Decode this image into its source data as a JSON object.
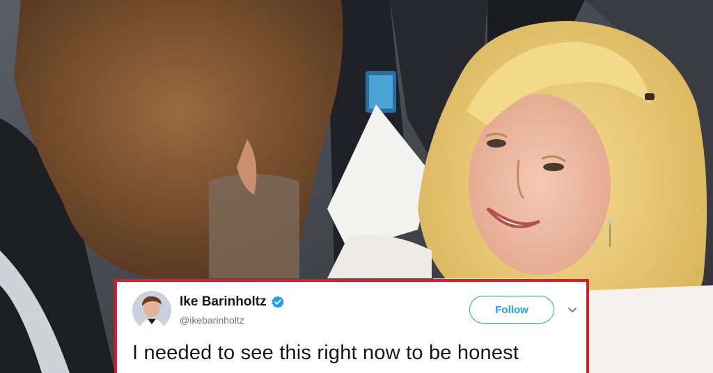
{
  "tweet": {
    "display_name": "Ike Barinholtz",
    "handle": "@ikebarinholtz",
    "follow_label": "Follow",
    "text": "I needed to see this right now to be honest",
    "verified_icon": "verified-badge-icon",
    "menu_icon": "chevron-down-icon"
  },
  "colors": {
    "card_border": "#d21f2a",
    "twitter_blue": "#1da1f2"
  }
}
